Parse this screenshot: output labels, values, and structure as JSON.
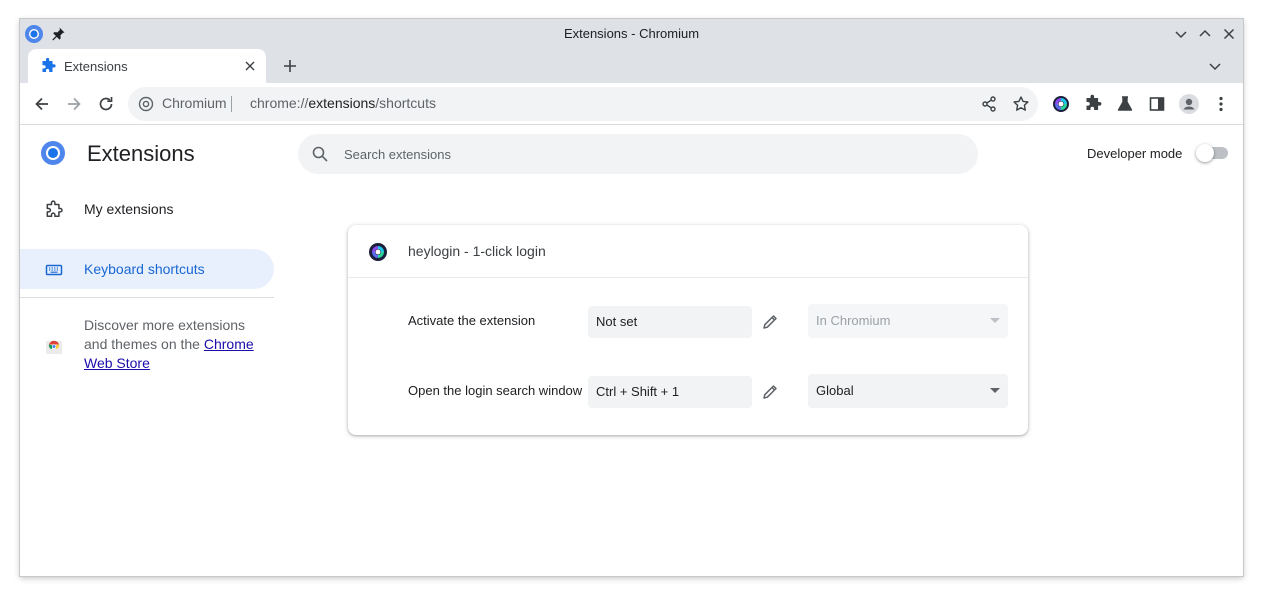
{
  "window": {
    "title": "Extensions - Chromium"
  },
  "tab": {
    "title": "Extensions"
  },
  "omnibox": {
    "site_name": "Chromium",
    "url_scheme": "chrome://",
    "url_host": "extensions",
    "url_path": "/shortcuts"
  },
  "page": {
    "brand_title": "Extensions",
    "search_placeholder": "Search extensions",
    "developer_mode_label": "Developer mode",
    "developer_mode_on": false
  },
  "sidebar": {
    "items": [
      {
        "label": "My extensions",
        "icon": "puzzle-outline-icon",
        "selected": false
      },
      {
        "label": "Keyboard shortcuts",
        "icon": "keyboard-icon",
        "selected": true
      }
    ],
    "store_text": "Discover more extensions and themes on the",
    "store_link": "Chrome Web Store"
  },
  "extension": {
    "name": "heylogin - 1-click login",
    "shortcuts": [
      {
        "label": "Activate the extension",
        "shortcut": "Not set",
        "scope": "In Chromium",
        "scope_enabled": false
      },
      {
        "label": "Open the login search window",
        "shortcut": "Ctrl + Shift + 1",
        "scope": "Global",
        "scope_enabled": true
      }
    ]
  },
  "colors": {
    "accent": "#1a73e8",
    "selected_bg": "#e8f0fe",
    "selected_text": "#1967d2",
    "chrome_bar": "#dee1e6"
  }
}
